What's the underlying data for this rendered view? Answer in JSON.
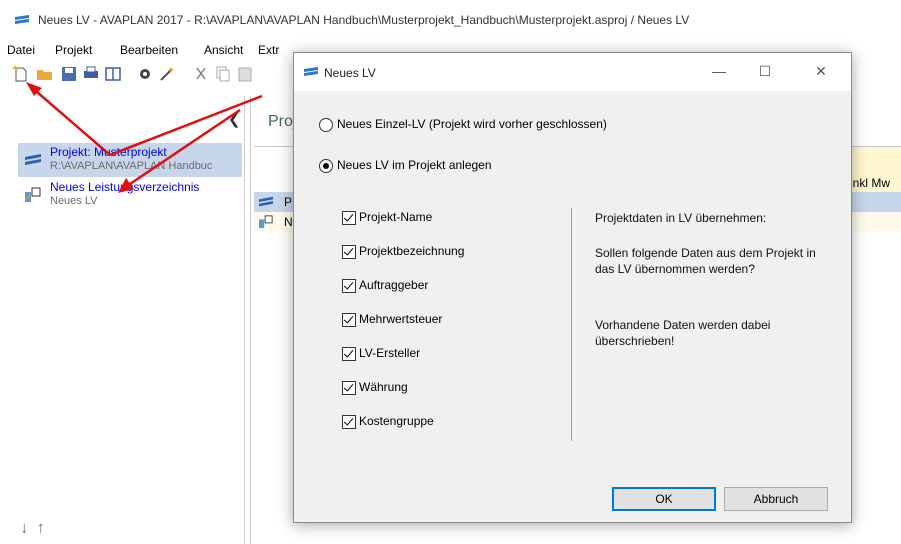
{
  "window": {
    "title": "Neues LV - AVAPLAN 2017 - R:\\AVAPLAN\\AVAPLAN Handbuch\\Musterprojekt_Handbuch\\Musterprojekt.asproj / Neues LV"
  },
  "menu": [
    {
      "label": "Datei"
    },
    {
      "label": "Projekt"
    },
    {
      "label": "Bearbeiten"
    },
    {
      "label": "Ansicht"
    },
    {
      "label": "Extr"
    }
  ],
  "toolbar_icons": [
    "new-icon",
    "open-folder-icon",
    "save-icon",
    "print-icon",
    "layout-icon",
    "settings-icon",
    "wand-icon",
    "cut-icon",
    "copy-icon",
    "paste-icon"
  ],
  "tree": [
    {
      "title": "Projekt: Musterprojekt",
      "subtitle": "R:\\AVAPLAN\\AVAPLAN Handbuc",
      "icon": "project-icon",
      "selected": true
    },
    {
      "title": "Neues Leistungsverzeichnis",
      "subtitle": "Neues LV",
      "icon": "lv-icon",
      "selected": false
    }
  ],
  "right": {
    "tab_label": "Proj",
    "column_header": "inkl Mw",
    "row1_label": "P",
    "row2_label": "N"
  },
  "dialog": {
    "title": "Neues LV",
    "radio_options": [
      {
        "label": "Neues Einzel-LV (Projekt wird vorher geschlossen)",
        "checked": false
      },
      {
        "label": "Neues LV im Projekt anlegen",
        "checked": true
      }
    ],
    "checkboxes": [
      {
        "label": "Projekt-Name",
        "checked": true
      },
      {
        "label": "Projektbezeichnung",
        "checked": true
      },
      {
        "label": "Auftraggeber",
        "checked": true
      },
      {
        "label": "Mehrwertsteuer",
        "checked": true
      },
      {
        "label": "LV-Ersteller",
        "checked": true
      },
      {
        "label": "Währung",
        "checked": true
      },
      {
        "label": "Kostengruppe",
        "checked": true
      }
    ],
    "info": {
      "heading": "Projektdaten in LV übernehmen:",
      "question": "Sollen folgende Daten aus dem Projekt in das LV übernommen werden?",
      "warning": "Vorhandene Daten werden dabei überschrieben!"
    },
    "ok_label": "OK",
    "cancel_label": "Abbruch"
  },
  "colors": {
    "accent": "#0078d7",
    "annotation_arrow": "#e01010",
    "tree_link": "#0000ff",
    "selection": "#c7d6ea"
  }
}
